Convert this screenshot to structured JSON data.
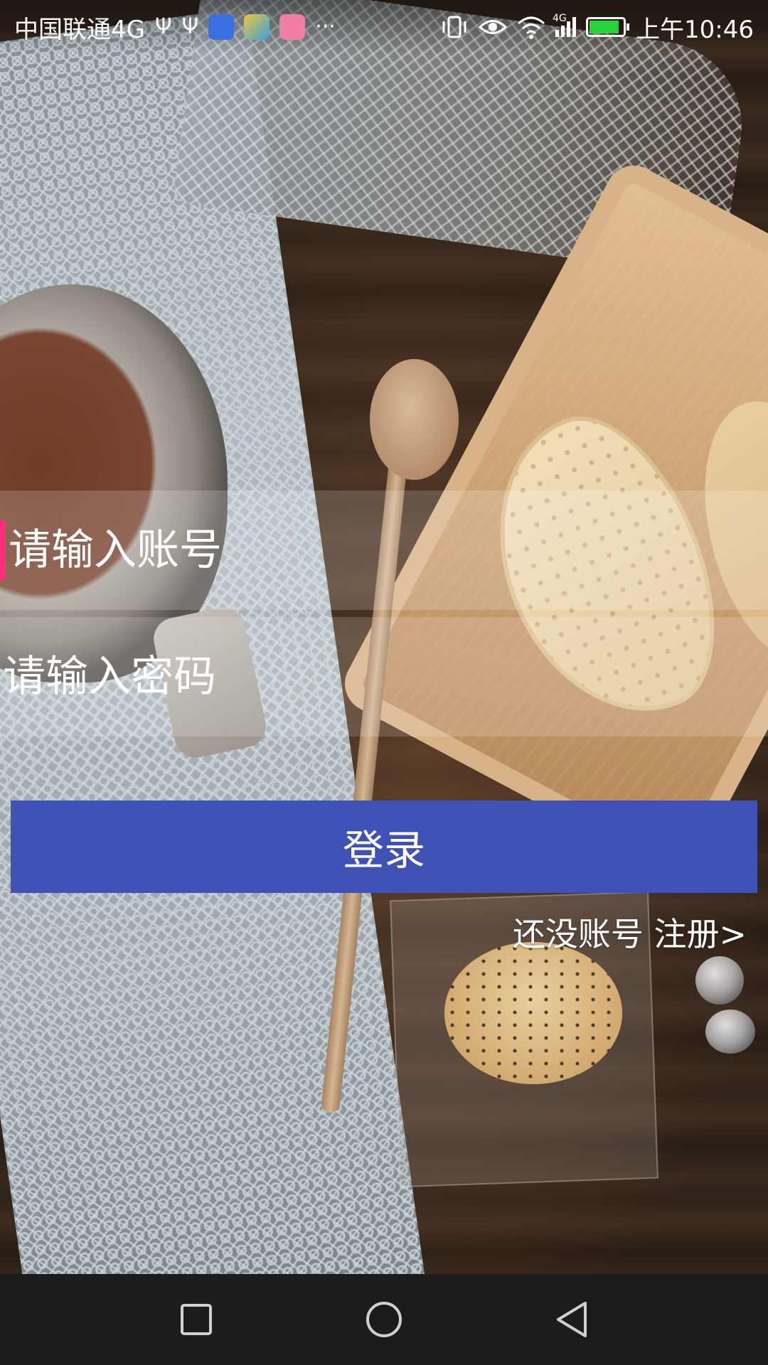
{
  "status_bar": {
    "carrier": "中国联通4G",
    "icons": [
      "usb-icon",
      "usb-icon",
      "baidu-app-icon",
      "telegram-app-icon",
      "bilibili-app-icon",
      "more-dots-icon",
      "vibrate-icon",
      "eye-icon",
      "wifi-icon",
      "signal-4g-icon",
      "battery-icon"
    ],
    "more_indicator": "···",
    "network_label": "4G",
    "time": "上午10:46",
    "battery_level": 0.9,
    "battery_color": "#27d53b"
  },
  "login": {
    "account_placeholder": "请输入账号",
    "password_placeholder": "请输入密码",
    "login_button": "登录",
    "register_link": "还没账号 注册>",
    "button_color": "#3f51b5",
    "caret_color": "#ff2d7a"
  },
  "nav_bar": {
    "icons": [
      "recent-apps-icon",
      "home-icon",
      "back-icon"
    ]
  }
}
